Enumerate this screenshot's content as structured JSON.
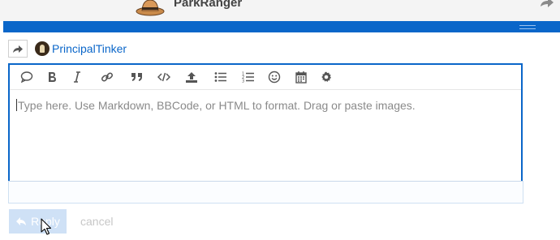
{
  "header": {
    "username": "ParkRanger"
  },
  "composer": {
    "reply_to_user": "PrincipalTinker",
    "editor": {
      "placeholder": "Type here. Use Markdown, BBCode, or HTML to format. Drag or paste images.",
      "toolbar": [
        {
          "name": "speech-bubble-icon",
          "title": "Insert quote"
        },
        {
          "name": "bold-icon",
          "title": "Bold"
        },
        {
          "name": "italic-icon",
          "title": "Italic"
        },
        {
          "name": "link-icon",
          "title": "Hyperlink"
        },
        {
          "name": "blockquote-icon",
          "title": "Blockquote"
        },
        {
          "name": "code-icon",
          "title": "Preformatted text"
        },
        {
          "name": "upload-icon",
          "title": "Upload"
        },
        {
          "name": "bulleted-list-icon",
          "title": "Bulleted list"
        },
        {
          "name": "numbered-list-icon",
          "title": "Numbered list"
        },
        {
          "name": "emoji-icon",
          "title": "Insert emoji"
        },
        {
          "name": "calendar-icon",
          "title": "Insert date"
        },
        {
          "name": "gear-icon",
          "title": "Options"
        }
      ]
    },
    "actions": {
      "reply_label": "Reply",
      "cancel_label": "cancel"
    }
  },
  "colors": {
    "accent": "#0a66c9",
    "reply_button_disabled": "#cfe1f6"
  }
}
